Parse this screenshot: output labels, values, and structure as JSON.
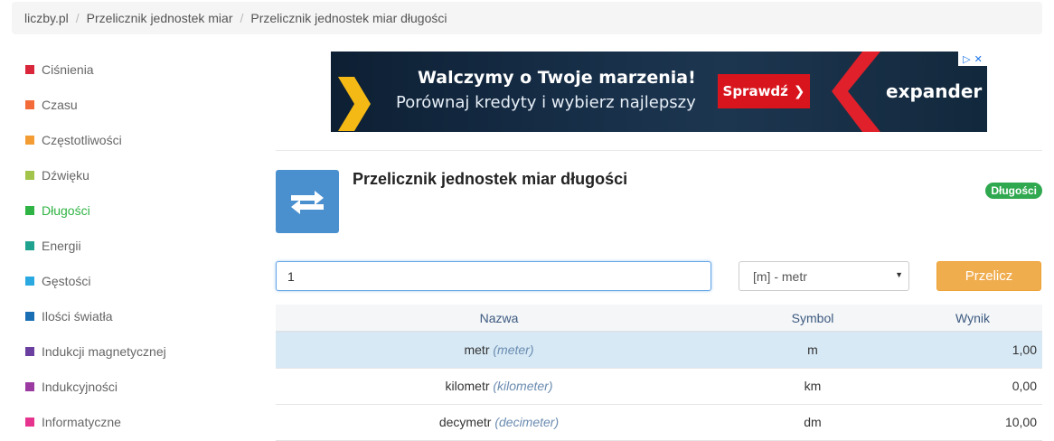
{
  "breadcrumb": [
    {
      "label": "liczby.pl"
    },
    {
      "label": "Przelicznik jednostek miar"
    },
    {
      "label": "Przelicznik jednostek miar długości"
    }
  ],
  "sidebar": {
    "items": [
      {
        "label": "Ciśnienia",
        "color": "#d9263b"
      },
      {
        "label": "Czasu",
        "color": "#f46b3a"
      },
      {
        "label": "Częstotliwości",
        "color": "#f39c34"
      },
      {
        "label": "Dźwięku",
        "color": "#a3c44a"
      },
      {
        "label": "Długości",
        "color": "#2fb344",
        "active": true
      },
      {
        "label": "Energii",
        "color": "#1fa38e"
      },
      {
        "label": "Gęstości",
        "color": "#2aa9e0"
      },
      {
        "label": "Ilości światła",
        "color": "#1a6fb4"
      },
      {
        "label": "Indukcji magnetycznej",
        "color": "#6b3fa0"
      },
      {
        "label": "Indukcyjności",
        "color": "#9b3aa0"
      },
      {
        "label": "Informatyczne",
        "color": "#e6348e"
      }
    ]
  },
  "ad": {
    "headline": "Walczymy o Twoje marzenia!",
    "subline": "Porównaj kredyty i wybierz najlepszy",
    "cta": "Sprawdź",
    "brand": "expander"
  },
  "tool": {
    "icon": "swap-arrows-icon",
    "title": "Przelicznik jednostek miar długości",
    "category_badge": "Długości"
  },
  "form": {
    "value": "1",
    "unit_selected": "[m] - metr",
    "convert_label": "Przelicz"
  },
  "results": {
    "headers": {
      "name": "Nazwa",
      "symbol": "Symbol",
      "result": "Wynik"
    },
    "rows": [
      {
        "name": "metr",
        "name_en": "(meter)",
        "symbol": "m",
        "result": "1,00"
      },
      {
        "name": "kilometr",
        "name_en": "(kilometer)",
        "symbol": "km",
        "result": "0,00"
      },
      {
        "name": "decymetr",
        "name_en": "(decimeter)",
        "symbol": "dm",
        "result": "10,00"
      }
    ]
  }
}
